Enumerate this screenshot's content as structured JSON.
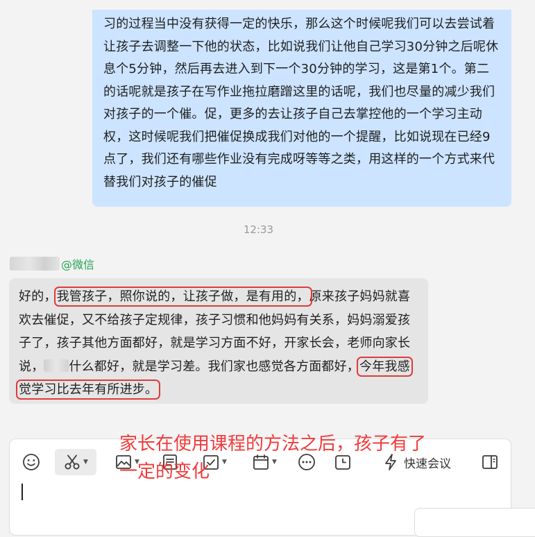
{
  "chat": {
    "sent_message": "习的过程当中没有获得一定的快乐，那么这个时候呢我们可以去尝试着让孩子去调整一下他的状态，比如说我们让他自己学习30分钟之后呢休息个5分钟，然后再去进入到下一个30分钟的学习，这是第1个。第二的话呢就是孩子在写作业拖拉磨蹭这里的话呢，我们也尽量的减少我们对孩子的一个催。促，更多的去让孩子自己去掌控他的一个学习主动权，这时候呢我们把催促换成我们对他的一个提醒，比如说现在已经9点了，我们还有哪些作业没有完成呀等等之类，用这样的一个方式来代替我们对孩子的催促",
    "timestamp": "12:33",
    "sender_tag": "@微信",
    "received": {
      "part1": "好的，",
      "highlight1": "我管孩子，照你说的，让孩子做，是有用的，",
      "part2": "原来孩子妈妈就喜欢去催促，又不给孩子定规律，孩子习惯和他妈妈有关系，妈妈溺爱孩子了，孩子其他方面都好，就是学习方面不好，开家长会，老师向家长说，",
      "part3": "什么都好，就是学习差。我们家也感觉各方面都好，",
      "highlight2": "今年我感觉学习比去年有所进步。"
    }
  },
  "annotation": {
    "text": "家长在使用课程的方法之后，孩子有了一定的变化",
    "color": "#f23a3a"
  },
  "composer": {
    "toolbar": [
      {
        "icon": "emoji-icon"
      },
      {
        "icon": "scissors-icon",
        "active": true,
        "has_dropdown": true
      },
      {
        "icon": "image-icon",
        "has_dropdown": true
      },
      {
        "icon": "document-icon"
      },
      {
        "icon": "task-check-icon",
        "has_dropdown": true
      },
      {
        "icon": "calendar-icon",
        "has_dropdown": true
      },
      {
        "icon": "more-icon"
      },
      {
        "icon": "clock-icon"
      },
      {
        "icon": "lightning-icon",
        "label": "快速会议"
      },
      {
        "icon": "sidebar-toggle-icon"
      }
    ]
  },
  "colors": {
    "sent_bubble": "#cce4ff",
    "received_bubble": "#e5e5e5",
    "highlight_box": "#e03a3a",
    "sender_tag": "#22a453"
  }
}
